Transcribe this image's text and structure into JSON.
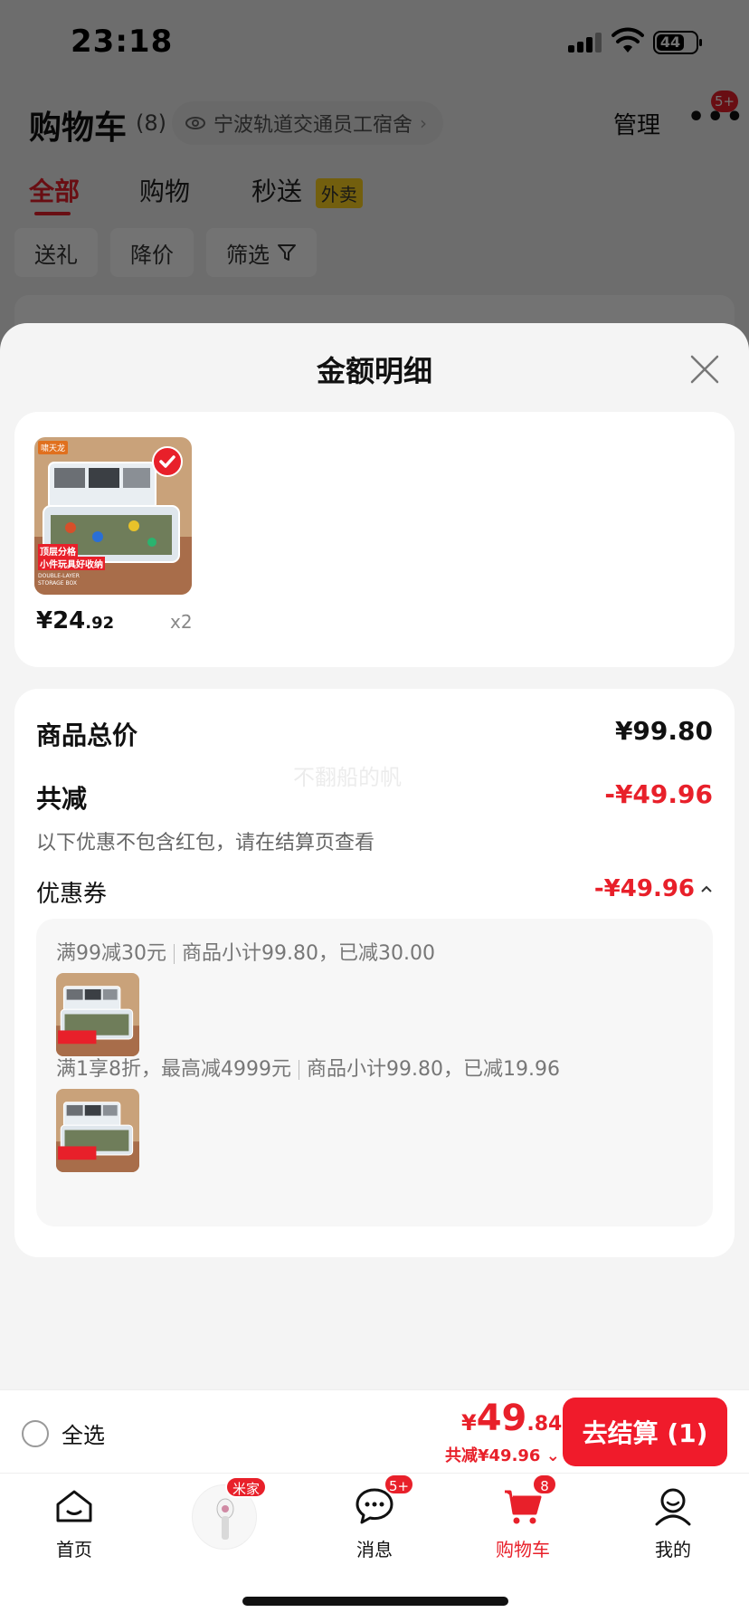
{
  "status_bar": {
    "time": "23:18",
    "battery": "44"
  },
  "header": {
    "title": "购物车",
    "count": "(8)",
    "address": "宁波轨道交通员工宿舍",
    "manage": "管理",
    "more_badge": "5+"
  },
  "tabs": [
    {
      "label": "全部"
    },
    {
      "label": "购物"
    },
    {
      "label": "秒送",
      "tag": "外卖"
    }
  ],
  "filters": [
    {
      "label": "送礼"
    },
    {
      "label": "降价"
    },
    {
      "label": "筛选"
    }
  ],
  "sheet": {
    "title": "金额明细",
    "product": {
      "price_symbol": "¥",
      "price_int": "24",
      "price_dec": ".92",
      "qty": "x2",
      "thumb_brand": "啸天龙",
      "thumb_caption_1": "顶层分格",
      "thumb_caption_2": "小件玩具好收纳",
      "thumb_caption_3": "DOUBLE-LAYER",
      "thumb_caption_4": "STORAGE BOX"
    },
    "detail": {
      "total_label": "商品总价",
      "total_value": "¥99.80",
      "discount_label": "共减",
      "discount_value": "-¥49.96",
      "discount_note": "以下优惠不包含红包，请在结算页查看",
      "watermark": "不翻船的帆",
      "coupon_label": "优惠券",
      "coupon_value": "-¥49.96",
      "coupons": [
        {
          "rule": "满99减30元",
          "detail": "商品小计99.80，已减30.00"
        },
        {
          "rule": "满1享8折，最高减4999元",
          "detail": "商品小计99.80，已减19.96"
        }
      ]
    }
  },
  "checkout": {
    "select_all": "全选",
    "total_symbol": "¥",
    "total_int": "49",
    "total_dec": ".84",
    "total_saving": "共减¥49.96",
    "button": "去结算 (1)"
  },
  "tabbar": [
    {
      "label": "首页",
      "icon": "home-icon"
    },
    {
      "label": "",
      "icon": "mijia-icon",
      "badge": "米家"
    },
    {
      "label": "消息",
      "icon": "message-icon",
      "badge": "5+"
    },
    {
      "label": "购物车",
      "icon": "cart-icon",
      "badge": "8"
    },
    {
      "label": "我的",
      "icon": "profile-icon"
    }
  ],
  "colors": {
    "accent": "#e8202a",
    "checkout_button": "#f01b2b",
    "tag_yellow": "#ffd21f"
  }
}
